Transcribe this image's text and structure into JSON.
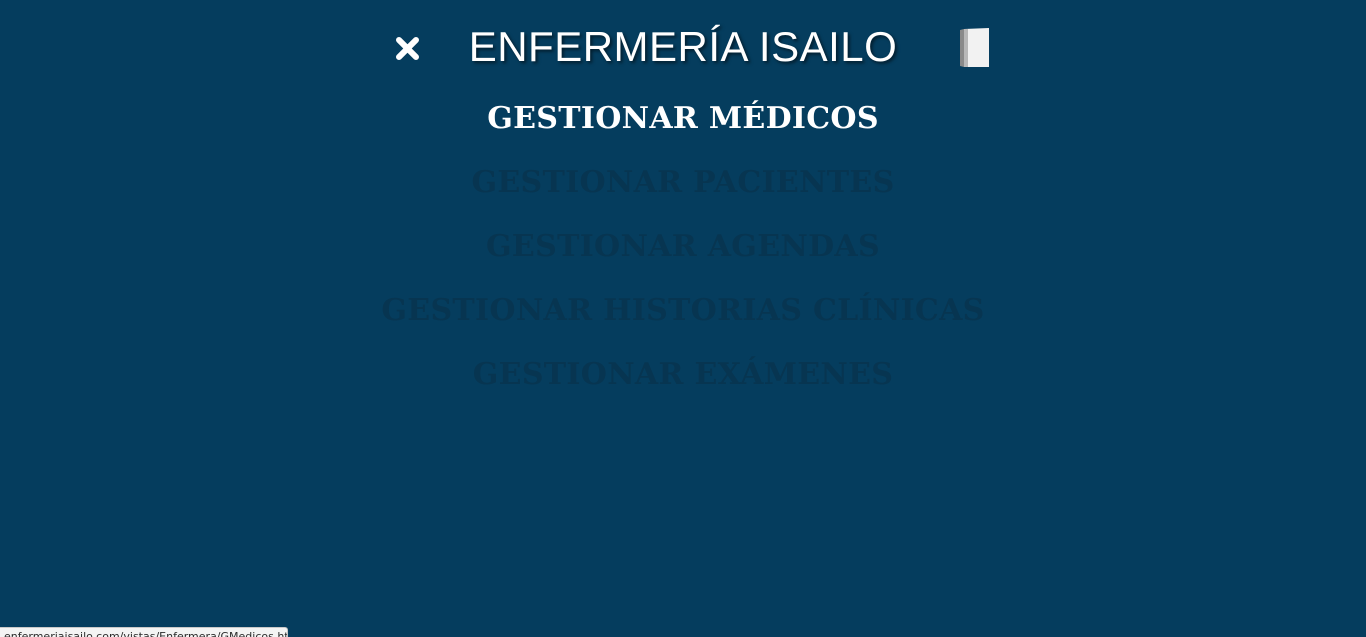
{
  "header": {
    "title": "ENFERMERÍA ISAILO",
    "close_icon": "close-icon",
    "logout_icon": "door-icon"
  },
  "menu": {
    "items": [
      {
        "label": "GESTIONAR MÉDICOS",
        "active": true
      },
      {
        "label": "GESTIONAR PACIENTES",
        "active": false
      },
      {
        "label": "GESTIONAR AGENDAS",
        "active": false
      },
      {
        "label": "GESTIONAR HISTORIAS CLÍNICAS",
        "active": false
      },
      {
        "label": "GESTIONAR EXÁMENES",
        "active": false
      }
    ]
  },
  "status_bar": {
    "url": "enfermeriaisailo.com/vistas/Enfermera/GMedicos.html"
  },
  "colors": {
    "background": "#053d5e",
    "menu_active": "#ffffff",
    "menu_inactive": "#073551"
  }
}
